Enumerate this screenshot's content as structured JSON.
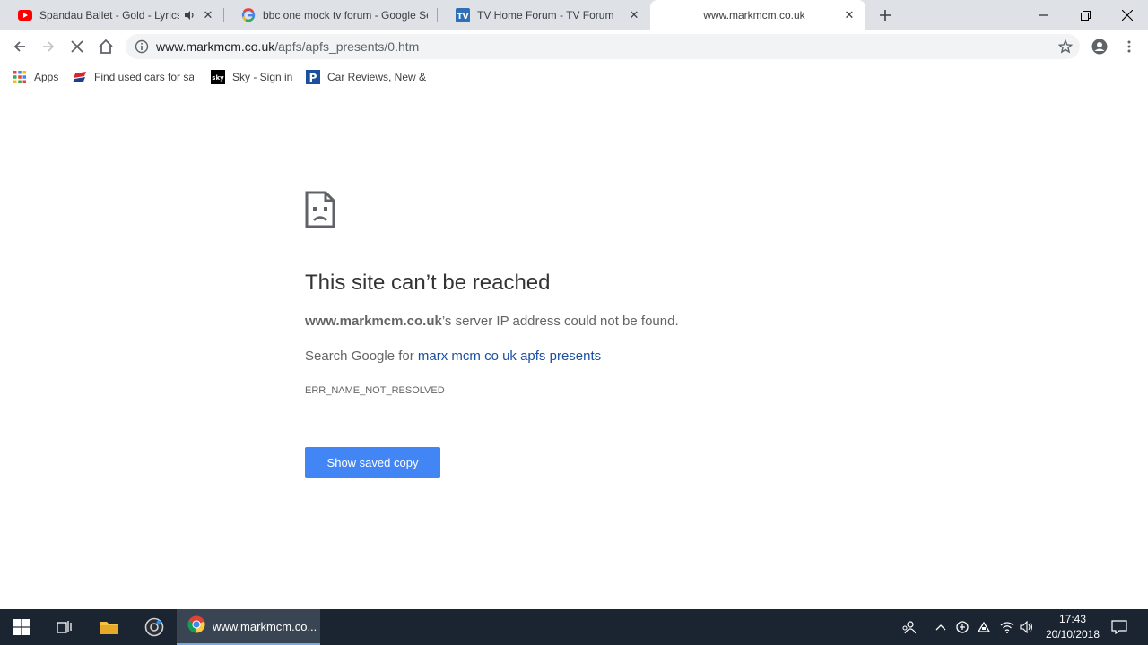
{
  "tabs": [
    {
      "title": "Spandau Ballet - Gold - Lyrics",
      "favicon": "youtube-icon",
      "audio": true
    },
    {
      "title": "bbc one mock tv forum - Google Search",
      "favicon": "google-icon"
    },
    {
      "title": "TV Home Forum - TV Forum",
      "favicon": "tv-forum-icon"
    },
    {
      "title": "www.markmcm.co.uk",
      "favicon": "none",
      "active": true
    }
  ],
  "omnibox": {
    "host": "www.markmcm.co.uk",
    "path": "/apfs/apfs_presents/0.htm"
  },
  "bookmarks": [
    {
      "label": "Apps",
      "icon": "apps-grid-icon"
    },
    {
      "label": "Find used cars for sale",
      "icon": "cars-icon"
    },
    {
      "label": "Sky - Sign in",
      "icon": "sky-icon"
    },
    {
      "label": "Car Reviews, New & Used",
      "icon": "p-icon"
    }
  ],
  "error": {
    "heading": "This site can’t be reached",
    "host": "www.markmcm.co.uk",
    "desc_suffix": "’s server IP address could not be found.",
    "search_prefix": "Search Google for ",
    "search_link": "marx mcm co uk apfs presents",
    "code": "ERR_NAME_NOT_RESOLVED",
    "button": "Show saved copy"
  },
  "taskbar": {
    "active_app_label": "www.markmcm.co...",
    "time": "17:43",
    "date": "20/10/2018"
  },
  "colors": {
    "accent": "#4285f4",
    "link": "#1a4fa0",
    "taskbar": "#1b2532",
    "tabstrip": "#dee1e6"
  }
}
